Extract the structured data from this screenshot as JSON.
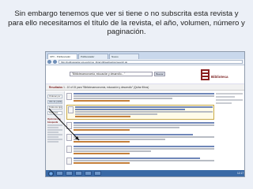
{
  "caption": "Sin embargo tenemos que ver si tiene o no subscrita esta revista y para ello necesitamos el título de la revista, el año, volumen, número y paginación.",
  "browser": {
    "tabs": [
      "UPV - Polibuscador",
      "Polibuscador",
      "Nuevo"
    ],
    "url": "http://polibuscador.upv.es/primo_library/libweb/action/search.do"
  },
  "site": {
    "search_value": "\"Bibliotecaeconomía, educación y desarrollo... \"",
    "search_button": "Buscar",
    "logo_text": "Biblioteca",
    "results_label": "Resultados",
    "results_text": "1 - 10 of 15 para \"Bibliotecaeconomía, educación y desarrollo\" (Quitar filtros)"
  },
  "sidebar": {
    "boxes": [
      "Ordenar por",
      "Año de publicación",
      "Todos los tipos",
      "Opciones"
    ],
    "label": "Opciones de búsqueda"
  },
  "taskbar": {
    "clock": "12:17"
  }
}
